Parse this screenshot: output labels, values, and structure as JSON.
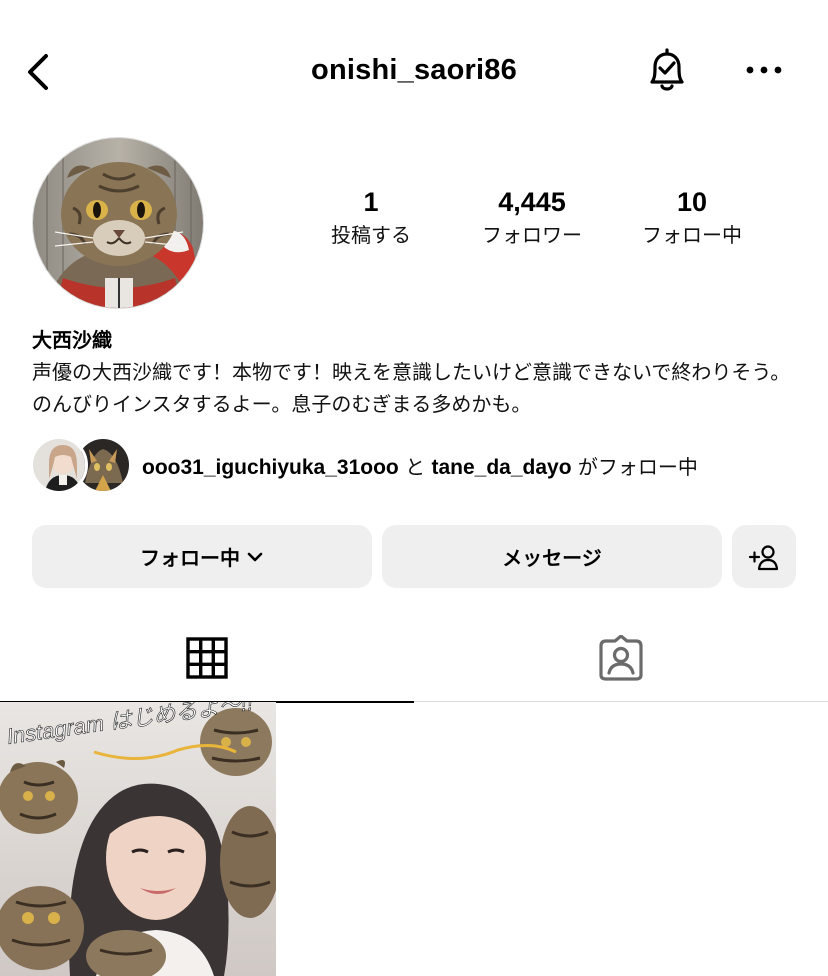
{
  "header": {
    "username": "onishi_saori86",
    "back_icon": "chevron-left-icon",
    "bell_icon": "bell-check-icon",
    "more_icon": "more-horizontal-icon"
  },
  "profile": {
    "stats": [
      {
        "value": "1",
        "label": "投稿する"
      },
      {
        "value": "4,445",
        "label": "フォロワー"
      },
      {
        "value": "10",
        "label": "フォロー中"
      }
    ],
    "display_name": "大西沙織",
    "bio": "声優の大西沙織です！本物です！映えを意識したいけど意識できないで終わりそう。のんびりインスタするよー。息子のむぎまる多めかも。"
  },
  "mutuals": {
    "user1": "ooo31_iguchiyuka_31ooo",
    "connector": "と",
    "user2": "tane_da_dayo",
    "suffix": "がフォロー中"
  },
  "actions": {
    "follow_label": "フォロー中",
    "message_label": "メッセージ"
  },
  "tabs": [
    {
      "icon": "grid-icon",
      "active": true
    },
    {
      "icon": "tagged-person-icon",
      "active": false
    }
  ],
  "post": {
    "overlay_text": "Instagram はじめるよ〜!!"
  }
}
